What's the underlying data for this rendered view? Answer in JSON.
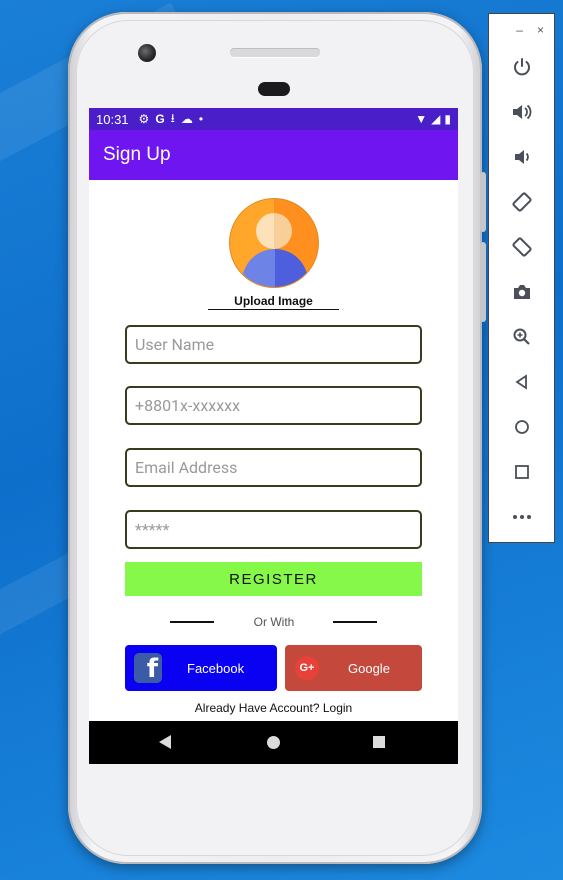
{
  "status_bar": {
    "time": "10:31"
  },
  "app_bar": {
    "title": "Sign Up"
  },
  "form": {
    "upload_label": "Upload Image",
    "username_placeholder": "User Name",
    "phone_placeholder": "+8801x-xxxxxx",
    "email_placeholder": "Email Address",
    "password_placeholder": "*****",
    "register_label": "REGISTER",
    "or_with": "Or With",
    "facebook_label": "Facebook",
    "google_label": "Google",
    "google_icon_text": "G+",
    "facebook_icon_text": "f",
    "login_prompt": "Already Have Account? Login"
  },
  "emulator_toolbar": {
    "minimize": "–",
    "close": "×",
    "buttons": [
      "power-icon",
      "volume-up-icon",
      "volume-down-icon",
      "rotate-left-icon",
      "rotate-right-icon",
      "camera-icon",
      "zoom-icon",
      "back-icon",
      "home-icon",
      "overview-icon",
      "more-icon"
    ]
  },
  "colors": {
    "status_bar": "#4a1fc9",
    "app_bar": "#6f16f0",
    "register": "#86f84a",
    "facebook": "#0a00f2",
    "google": "#c4483c",
    "desktop": "#1a7fd6"
  }
}
